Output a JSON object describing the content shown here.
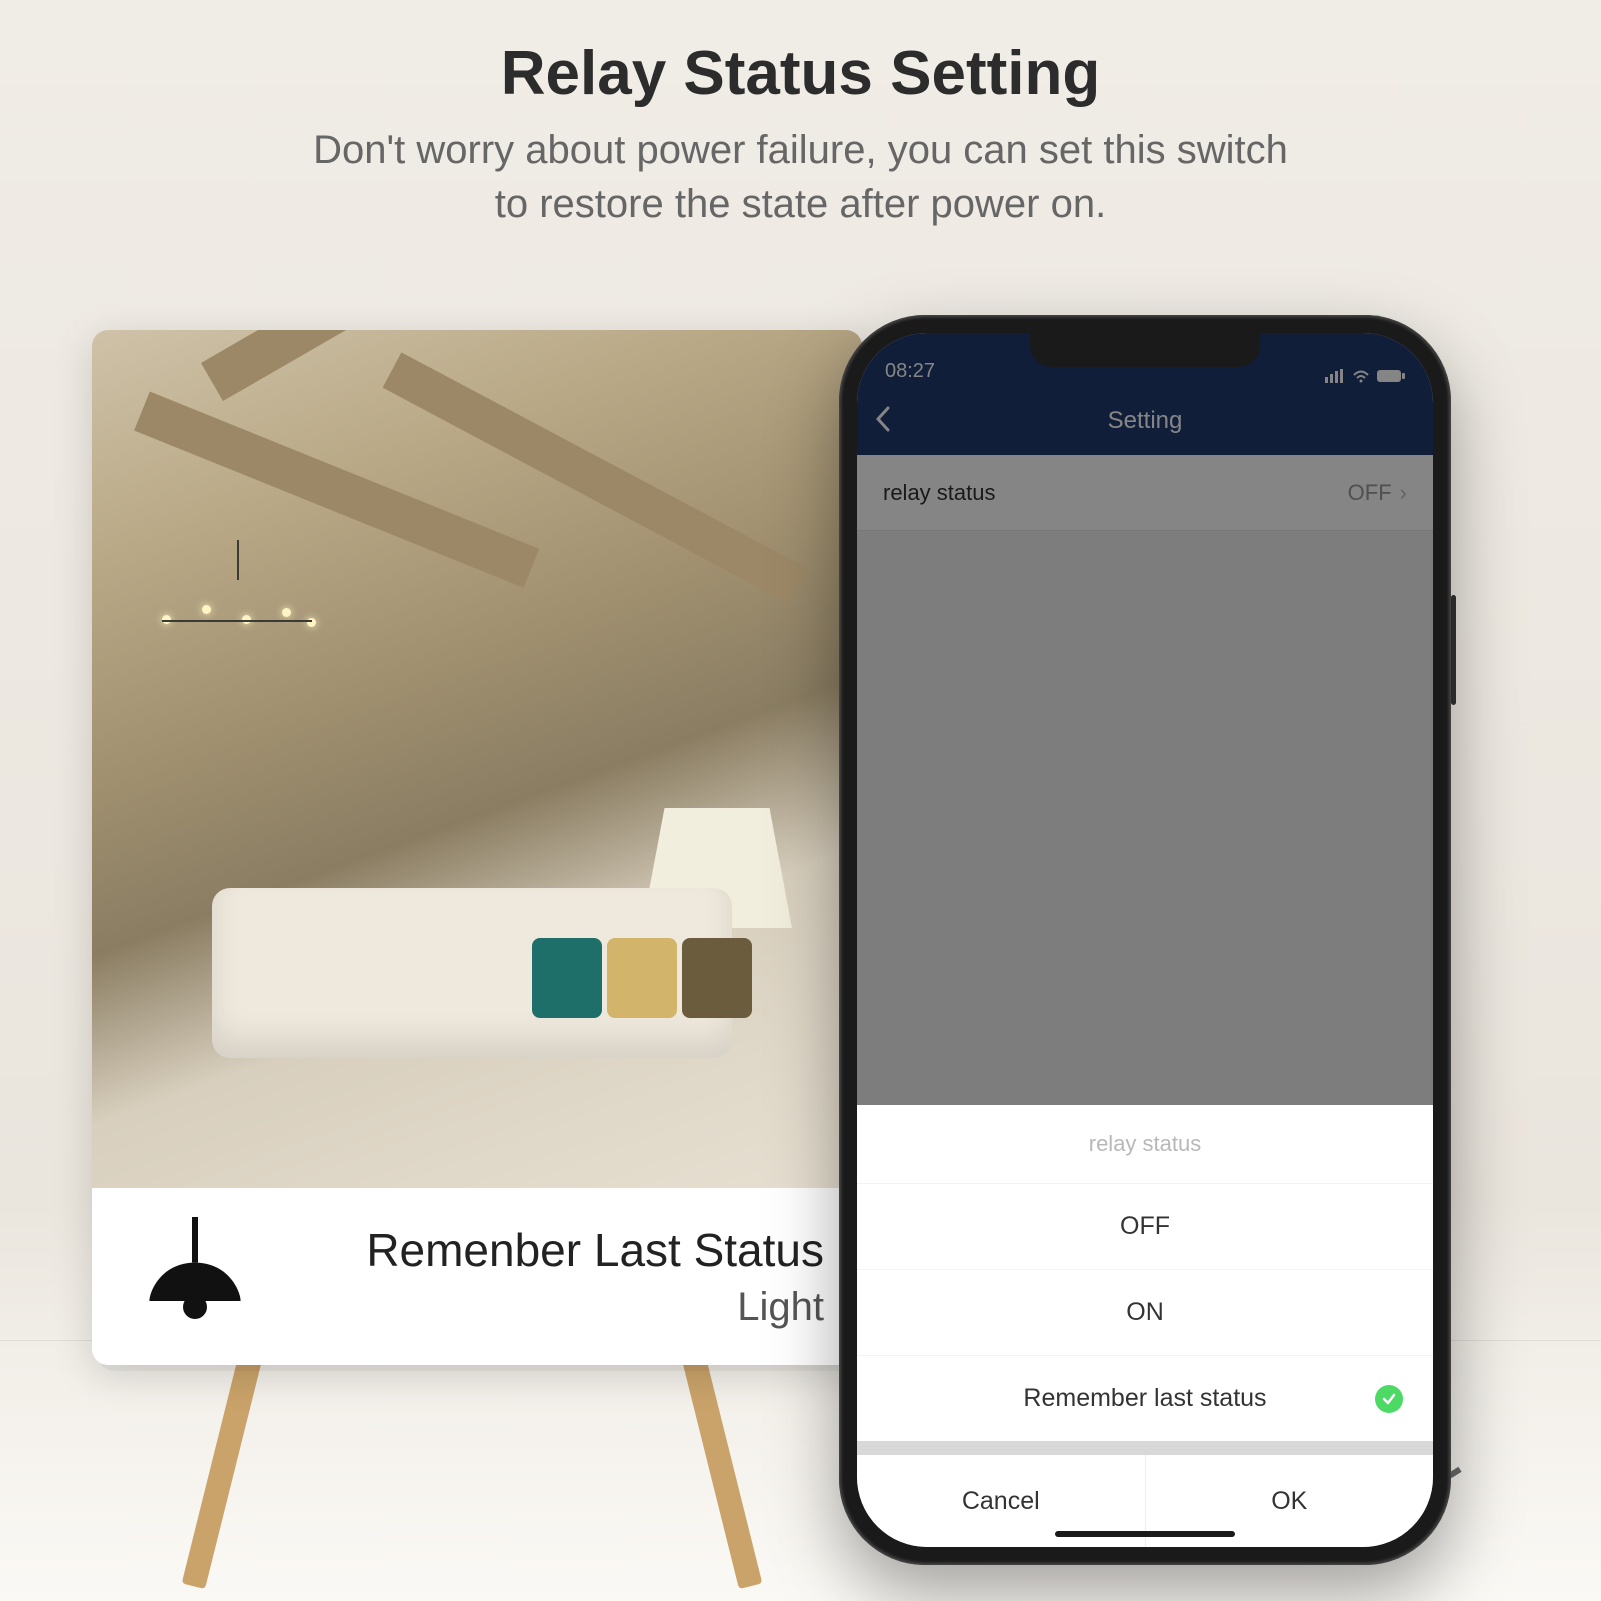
{
  "header": {
    "title": "Relay Status Setting",
    "subtitle": "Don't worry about power failure, you can set this switch\nto restore the state after power on."
  },
  "card": {
    "title": "Remenber Last Status",
    "subtitle": "Light",
    "icon": "pendant-lamp-icon"
  },
  "phone": {
    "statusbar": {
      "time": "08:27"
    },
    "nav": {
      "title": "Setting",
      "back_icon": "chevron-left-icon"
    },
    "rows": [
      {
        "label": "relay status",
        "value": "OFF"
      }
    ],
    "sheet": {
      "title": "relay status",
      "options": [
        {
          "label": "OFF",
          "selected": false
        },
        {
          "label": "ON",
          "selected": false
        },
        {
          "label": "Remember last status",
          "selected": true
        }
      ],
      "buttons": {
        "cancel": "Cancel",
        "ok": "OK"
      }
    }
  }
}
